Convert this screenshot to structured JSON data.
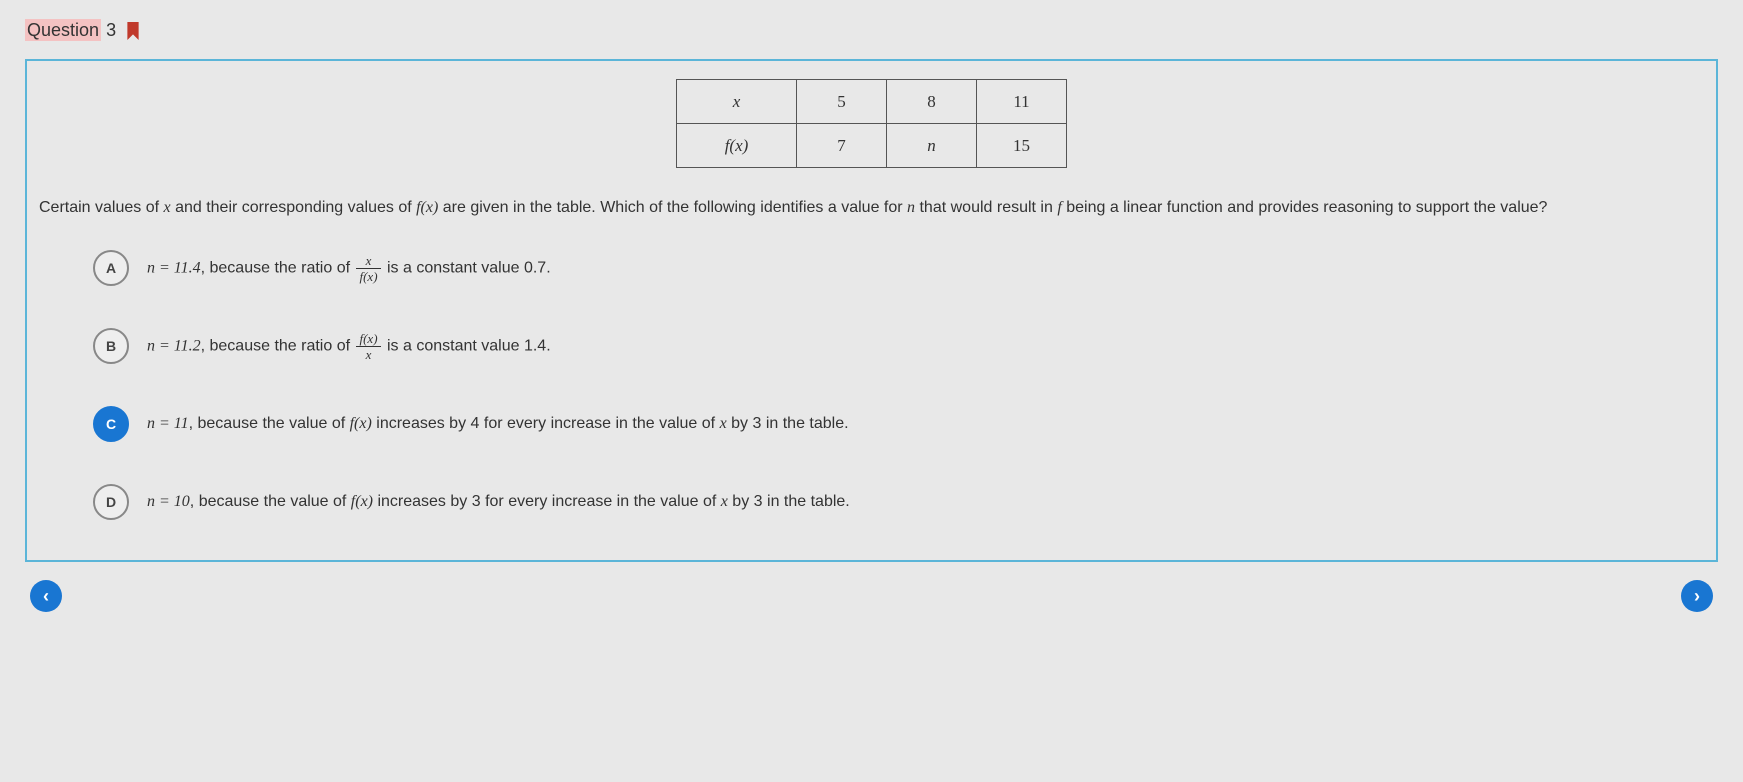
{
  "header": {
    "label_prefix": "Question",
    "number": "3"
  },
  "table": {
    "row1": {
      "hdr": "x",
      "c1": "5",
      "c2": "8",
      "c3": "11"
    },
    "row2": {
      "hdr": "f(x)",
      "c1": "7",
      "c2": "n",
      "c3": "15"
    }
  },
  "stem": {
    "p1": "Certain values of ",
    "v1": "x",
    "p2": " and their corresponding values of ",
    "v2": "f(x)",
    "p3": " are given in the table. Which of the following identifies a value for ",
    "v3": "n",
    "p4": " that would result in ",
    "v4": "f",
    "p5": " being a linear function and provides reasoning to support the value?"
  },
  "choices": {
    "A": {
      "letter": "A",
      "t1": "n = 11.4",
      "t2": ", because the ratio of ",
      "frac_num": "x",
      "frac_den": "f(x)",
      "t3": " is a constant value ",
      "t4": "0.7",
      "t5": "."
    },
    "B": {
      "letter": "B",
      "t1": "n = 11.2",
      "t2": ", because the ratio of ",
      "frac_num": "f(x)",
      "frac_den": "x",
      "t3": " is a constant value ",
      "t4": "1.4",
      "t5": "."
    },
    "C": {
      "letter": "C",
      "t1": "n = 11",
      "t2": ", because the value of ",
      "v1": "f(x)",
      "t3": " increases by ",
      "t4": "4",
      "t5": " for every increase in the value of ",
      "v2": "x",
      "t6": " by ",
      "t7": "3",
      "t8": " in the table."
    },
    "D": {
      "letter": "D",
      "t1": "n = 10",
      "t2": ", because the value of ",
      "v1": "f(x)",
      "t3": " increases by ",
      "t4": "3",
      "t5": " for every increase in the value of ",
      "v2": "x",
      "t6": " by ",
      "t7": "3",
      "t8": " in the table."
    }
  },
  "nav": {
    "prev": "‹",
    "next": "›"
  },
  "chart_data": {
    "type": "table",
    "columns": [
      "x",
      "f(x)"
    ],
    "rows": [
      {
        "x": 5,
        "f(x)": 7
      },
      {
        "x": 8,
        "f(x)": "n"
      },
      {
        "x": 11,
        "f(x)": 15
      }
    ]
  }
}
